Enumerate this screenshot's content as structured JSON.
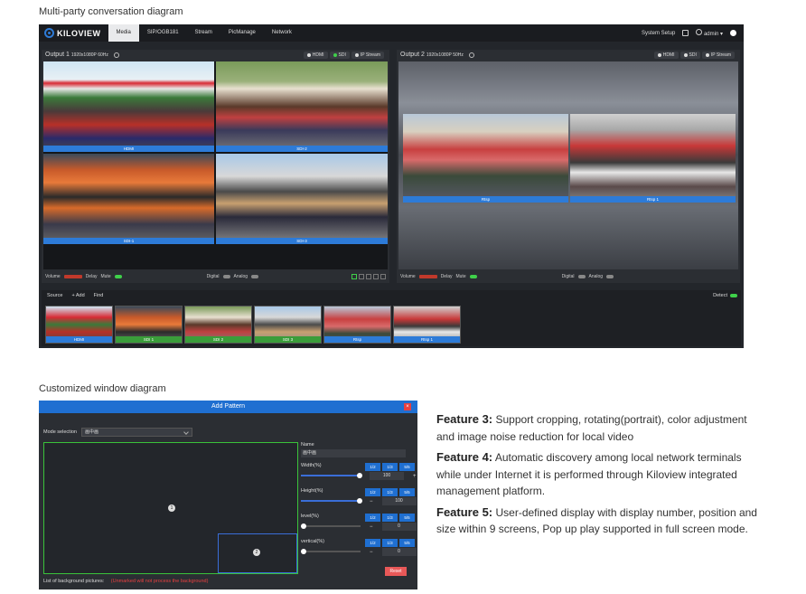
{
  "captions": {
    "multi_party": "Multi-party conversation diagram",
    "customized": "Customized window diagram"
  },
  "app": {
    "logo": "KILOVIEW",
    "nav_tabs": [
      "Media",
      "SIP/OGB181",
      "Stream",
      "PicManage",
      "Network"
    ],
    "active_tab": "Media",
    "system_setup": "System Setup",
    "user": "admin",
    "accent": "#2d7bd8"
  },
  "output1": {
    "title": "Output 1",
    "resolution": "1920x1080P 60Hz",
    "sources": [
      "HDMI",
      "SDI",
      "IP Stream"
    ],
    "active_source": "SDI",
    "tiles": [
      "HDMI",
      "SDI-2",
      "SDI-1",
      "SDI-3"
    ],
    "footer": {
      "volume": "Volume",
      "delay": "Delay",
      "mute": "Mute",
      "digital": "Digital",
      "analog": "Analog"
    }
  },
  "output2": {
    "title": "Output 2",
    "resolution": "1920x1080P 50Hz",
    "sources": [
      "HDMI",
      "SDI",
      "IP Stream"
    ],
    "tiles": [
      "Rtsp",
      "Rtsp 1"
    ],
    "footer": {
      "volume": "Volume",
      "delay": "Delay",
      "mute": "Mute",
      "digital": "Digital",
      "analog": "Analog"
    }
  },
  "sources_bar": {
    "label": "Source",
    "add": "+ Add",
    "find": "Find",
    "detect": "Detect",
    "thumbs": [
      {
        "label": "HDMI",
        "kind": "hdmi"
      },
      {
        "label": "SDI 1",
        "kind": "sdi"
      },
      {
        "label": "SDI 2",
        "kind": "sdi"
      },
      {
        "label": "SDI 3",
        "kind": "sdi"
      },
      {
        "label": "Rtsp",
        "kind": "ip"
      },
      {
        "label": "Rtsp 1",
        "kind": "ip"
      }
    ]
  },
  "dialog": {
    "title": "Add Pattern",
    "close": "×",
    "mode_label": "Mode selection",
    "mode_value": "画中画",
    "name_label": "Name",
    "name_value": "画中画",
    "width_label": "Width(%)",
    "height_label": "Height(%)",
    "level_label": "level(%)",
    "vertical_label": "vertical(%)",
    "ratios": [
      "1/2",
      "1/3",
      "5/5"
    ],
    "width_value": "100",
    "height_value": "100",
    "level_value": "0",
    "vertical_value": "0",
    "window1": "1",
    "window2": "2",
    "bg_label": "List of background pictures:",
    "bg_warning": "(Unmarked will not process the background)",
    "reset": "Reset"
  },
  "features": [
    {
      "head": "Feature 3:",
      "text": "Support cropping, rotating(portrait), color adjustment and image noise reduction for local video"
    },
    {
      "head": "Feature 4:",
      "text": "Automatic discovery among local network terminals while under Internet it is performed through Kiloview integrated management platform."
    },
    {
      "head": "Feature 5:",
      "text": "User-defined display with display number, position and size within 9 screens, Pop up play supported in full screen mode."
    }
  ]
}
